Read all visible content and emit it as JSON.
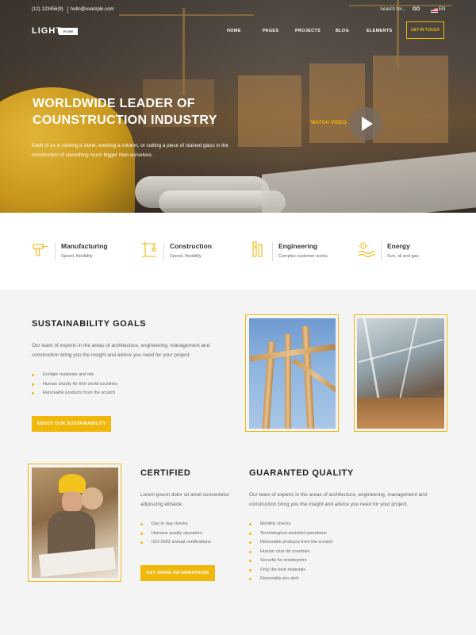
{
  "topbar": {
    "phone": "(12) 123456(9)",
    "email": "hello@example.com",
    "search_label": "Search for...",
    "go_label": "GO",
    "language": "EN"
  },
  "header": {
    "logo_text": "LIGHT",
    "logo_badge": "FLOW",
    "nav": [
      "HOME",
      "PAGES",
      "PROJECTS",
      "BLOG",
      "ELEMENTS"
    ],
    "cta": "GET IN TOUCH"
  },
  "hero": {
    "title_line1": "WORLDWIDE LEADER OF",
    "title_line2": "COUNSTRUCTION INDUSTRY",
    "text": "Each of us is carving a stone, erecting a column, or cutting a piece of stained glass in the construction of something much bigger than ourselves.",
    "watch_label": "WATCH VIDEO"
  },
  "features": [
    {
      "title": "Manufacturing",
      "subtitle": "Speed, flexibility",
      "icon": "drill-icon"
    },
    {
      "title": "Construction",
      "subtitle": "Speed, flexibility",
      "icon": "crane-icon"
    },
    {
      "title": "Engineering",
      "subtitle": "Complex customer works",
      "icon": "tools-icon"
    },
    {
      "title": "Energy",
      "subtitle": "Sun, oil and gas",
      "icon": "sun-icon"
    }
  ],
  "sustainability": {
    "title": "SUSTAINABILITY GOALS",
    "text": "Our team of experts in the areas of architecture, engineering, management and construction bring you the insight and advice you need for your project.",
    "bullets": [
      "Ecoligic materials and oils",
      "Human charity for thirt world countries",
      "Renovable products from the scratch"
    ],
    "button": "ABOUT OUR SUSTAINABILITY"
  },
  "certified": {
    "title": "CERTIFIED",
    "text": "Lorem ipsum dolor sit amet consectetur adipiscing elitsede.",
    "bullets": [
      "Day to day checks",
      "Humans quality operators",
      "ISO-2002 annual certifications"
    ],
    "button": "GET MORE INFORMATIONS"
  },
  "quality": {
    "title": "GUARANTED QUALITY",
    "text": "Our team of experts in the areas of architecture, engineering, management and construction bring you the insight and advice you need for your project.",
    "bullets": [
      "Monthly checks",
      "Technological assisted operations",
      "Renovable products from the scratch",
      "Human char rid countries",
      "Security for employeers",
      "Only the best materials",
      "Renovable pro atch"
    ]
  },
  "colors": {
    "accent": "#f0b80a",
    "dark": "#222222",
    "bg": "#f4f4f4"
  }
}
